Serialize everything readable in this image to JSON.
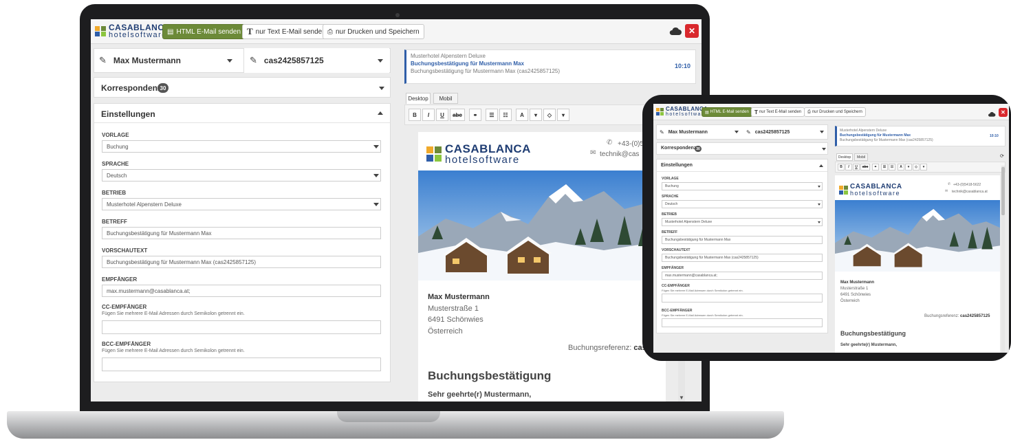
{
  "app": {
    "logo_top": "CASABLANCA",
    "logo_bottom": "hotelsoftware",
    "btn_html": "HTML E-Mail senden",
    "btn_text": "nur Text E-Mail senden",
    "btn_print": "nur Drucken und Speichern",
    "close": "✕",
    "cloud_icon": "cloud-icon"
  },
  "form": {
    "guest": "Max Mustermann",
    "booking_no": "cas2425857125",
    "correspondence": "Korrespondenz",
    "correspondence_count": "30",
    "settings": "Einstellungen",
    "template_label": "VORLAGE",
    "template_value": "Buchung",
    "language_label": "SPRACHE",
    "language_value": "Deutsch",
    "business_label": "BETRIEB",
    "business_value": "Musterhotel Alpenstern Deluxe",
    "subject_label": "BETREFF",
    "subject_value": "Buchungsbestätigung für Mustermann Max",
    "preview_label": "VORSCHAUTEXT",
    "preview_value": "Buchungsbestätigung für Mustermann Max (cas2425857125)",
    "recipient_label": "EMPFÄNGER",
    "recipient_value": "max.mustermann@casablanca.at;",
    "cc_label": "CC-EMPFÄNGER",
    "cc_hint": "Fügen Sie mehrere E-Mail Adressen durch Semikolon getrennt ein.",
    "bcc_label": "BCC-EMPFÄNGER",
    "bcc_hint": "Fügen Sie mehrere E-Mail Adressen durch Semikolon getrennt ein."
  },
  "preview": {
    "sender": "Musterhotel Alpenstern Deluxe",
    "subject": "Buchungsbestätigung für Mustermann Max",
    "snippet": "Buchungsbestätigung für Mustermann Max (cas2425857125)",
    "time": "10:10",
    "tab_desktop": "Desktop",
    "tab_mobile": "Mobil",
    "toolbar": [
      "B",
      "I",
      "U",
      "abc",
      "⚭",
      "☰",
      "☷",
      "A",
      "▾",
      "◇",
      "▾"
    ]
  },
  "email": {
    "phone_laptop": "+43-(0)5",
    "email_laptop": "technik@cas",
    "phone_tablet": "+43-(0)5418-5622",
    "email_tablet": "technik@casablanca.at",
    "name": "Max Mustermann",
    "street": "Musterstraße 1",
    "city": "6491 Schönwies",
    "country": "Österreich",
    "ref_label": "Buchungsreferenz:",
    "ref_laptop": "cas242",
    "ref_tablet": "cas2425857125",
    "heading": "Buchungsbestätigung",
    "greeting": "Sehr geehrte(r) Mustermann,"
  },
  "colors": {
    "brand_green": "#6c8a38",
    "brand_blue": "#1f3d73",
    "close_red": "#d9282d",
    "accent_blue": "#2f5ea8"
  }
}
